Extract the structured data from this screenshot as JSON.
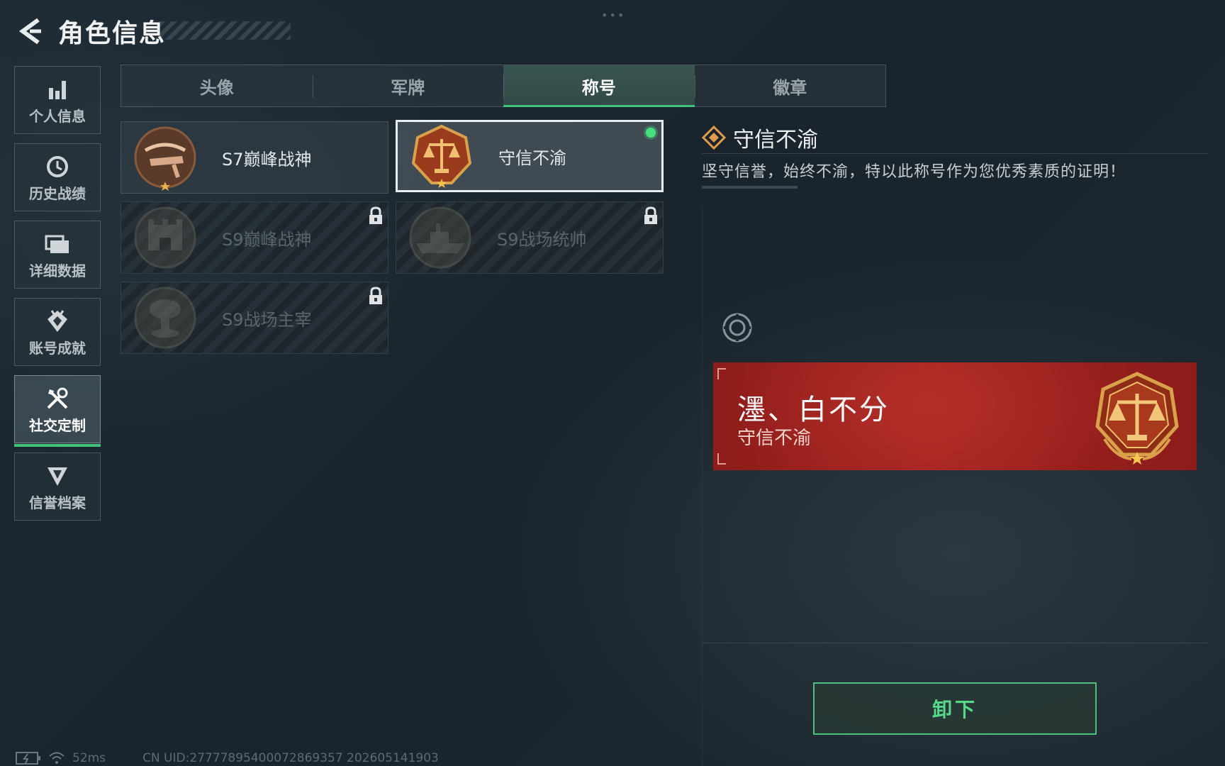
{
  "header": {
    "title": "角色信息"
  },
  "sidebar": {
    "items": [
      {
        "label": "个人信息",
        "icon": "bar-chart-icon"
      },
      {
        "label": "历史战绩",
        "icon": "clock-icon"
      },
      {
        "label": "详细数据",
        "icon": "folder-icon"
      },
      {
        "label": "账号成就",
        "icon": "achievement-icon"
      },
      {
        "label": "社交定制",
        "icon": "tools-icon",
        "active": true
      },
      {
        "label": "信誉档案",
        "icon": "credit-shield-icon"
      }
    ]
  },
  "tabs": [
    {
      "label": "头像"
    },
    {
      "label": "军牌"
    },
    {
      "label": "称号",
      "active": true
    },
    {
      "label": "徽章"
    }
  ],
  "titles": [
    {
      "name": "S7巅峰战神",
      "locked": false,
      "icon": "crossbow-emblem-icon"
    },
    {
      "name": "守信不渝",
      "locked": false,
      "selected": true,
      "equipped": true,
      "icon": "scales-emblem-icon"
    },
    {
      "name": "S9巅峰战神",
      "locked": true,
      "icon": "fortress-emblem-icon"
    },
    {
      "name": "S9战场统帅",
      "locked": true,
      "icon": "warship-emblem-icon"
    },
    {
      "name": "S9战场主宰",
      "locked": true,
      "icon": "mushroom-cloud-emblem-icon"
    }
  ],
  "detail": {
    "name": "守信不渝",
    "description": "坚守信誉，始终不渝，特以此称号作为您优秀素质的证明！"
  },
  "preview": {
    "player_name": "濹、白不分",
    "title": "守信不渝"
  },
  "actions": {
    "unequip_label": "卸下"
  },
  "footer": {
    "ping": "52ms",
    "uid": "CN UID:27777895400072869357 202605141903"
  },
  "colors": {
    "accent_green": "#3fc37c",
    "banner_red": "#a52421",
    "medal_gold": "#d9a24a"
  }
}
